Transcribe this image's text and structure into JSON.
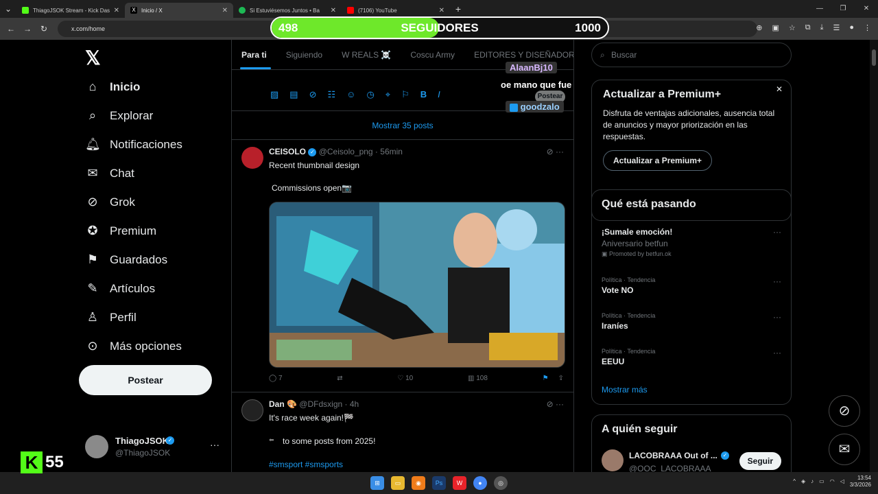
{
  "browser": {
    "tabs": [
      {
        "title": "ThiagoJSOK Stream - Kick Dash",
        "color": "#53fc18"
      },
      {
        "title": "Inicio / X",
        "color": "#222"
      },
      {
        "title": "Si Estuviésemos Juntos • Ba",
        "color": "#1db954"
      },
      {
        "title": "(7106) YouTube",
        "color": "#ff0000"
      }
    ],
    "url": "x.com/home"
  },
  "stream_overlay": {
    "followers_current": "498",
    "followers_label": "SEGUIDORES",
    "followers_goal": "1000",
    "followers_progress": 0.498,
    "chat_user1": "AlaanBj10",
    "chat_msg1": "oe mano que fue",
    "chat_user2": "goodzalo",
    "kick_count": "55"
  },
  "sidebar": {
    "items": [
      {
        "label": "Inicio",
        "icon": "home-icon"
      },
      {
        "label": "Explorar",
        "icon": "search-icon"
      },
      {
        "label": "Notificaciones",
        "icon": "bell-icon"
      },
      {
        "label": "Chat",
        "icon": "mail-icon"
      },
      {
        "label": "Grok",
        "icon": "grok-icon"
      },
      {
        "label": "Premium",
        "icon": "verified-icon"
      },
      {
        "label": "Guardados",
        "icon": "bookmark-icon"
      },
      {
        "label": "Artículos",
        "icon": "article-icon"
      },
      {
        "label": "Perfil",
        "icon": "person-icon"
      },
      {
        "label": "Más opciones",
        "icon": "more-icon"
      }
    ],
    "post_button": "Postear",
    "profile_name": "ThiagoJSOK",
    "profile_handle": "@ThiagoJSOK"
  },
  "feed": {
    "tabs": [
      "Para ti",
      "Siguiendo",
      "W REALS ☠️",
      "Coscu Army",
      "EDITORES Y DISEÑADOR"
    ],
    "compose_post_label": "Postear",
    "show_posts": "Mostrar 35 posts",
    "posts": [
      {
        "name": "CEISOLO",
        "handle": "@Ceisolo_png · 56min",
        "text1": "Recent thumbnail design",
        "text2": "Commissions open📷",
        "replies": "7",
        "likes": "10",
        "views": "108"
      },
      {
        "name": "Dan 🎨",
        "handle": "@DFdsxign · 4h",
        "text1": "It's race week again!🏁",
        "text2": "to some posts from 2025!",
        "text3": "#smsport #smsports"
      }
    ]
  },
  "right": {
    "search_placeholder": "Buscar",
    "premium": {
      "title": "Actualizar a Premium+",
      "desc": "Disfruta de ventajas adicionales, ausencia total de anuncios y mayor priorización en las respuestas.",
      "button": "Actualizar a Premium+"
    },
    "trends_title": "Qué está pasando",
    "trends": [
      {
        "sub": "",
        "title": "¡Sumale emoción!",
        "extra": "Aniversario betfun",
        "promo": "Promoted by betfun.ok"
      },
      {
        "sub": "Política · Tendencia",
        "title": "Vote NO"
      },
      {
        "sub": "Política · Tendencia",
        "title": "Iraníes"
      },
      {
        "sub": "Política · Tendencia",
        "title": "EEUU"
      }
    ],
    "show_more": "Mostrar más",
    "follow_title": "A quién seguir",
    "follow_name": "LACOBRAAA Out of ...",
    "follow_handle": "@OOC_LACOBRAAA",
    "follow_button": "Seguir"
  },
  "system": {
    "time": "13:54",
    "date": "3/3/2026"
  }
}
